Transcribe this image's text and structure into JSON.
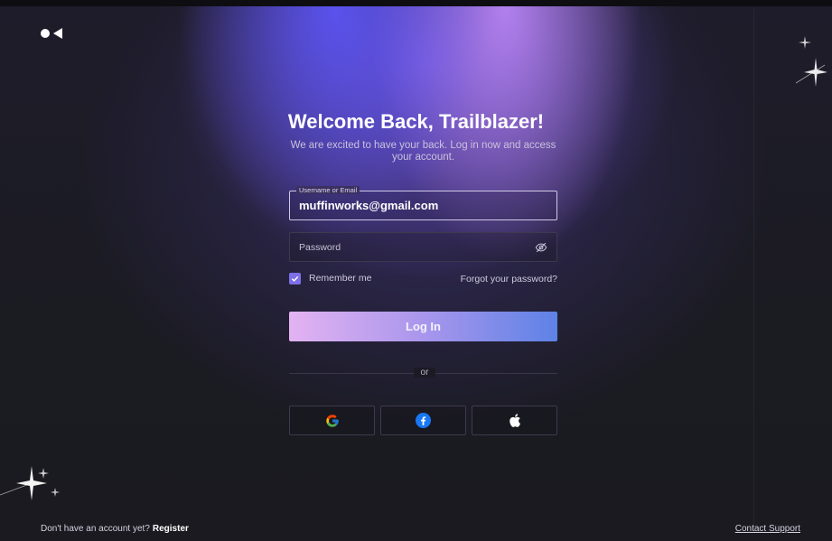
{
  "brand": {
    "logo": "logo-mark"
  },
  "header": {
    "title": "Welcome Back, Trailblazer!",
    "subtitle": "We are excited to have your back. Log in now and access your account."
  },
  "form": {
    "username": {
      "label": "Username or Email",
      "value": "muffinworks@gmail.com"
    },
    "password": {
      "placeholder": "Password",
      "icon": "eye-off-icon"
    },
    "remember": {
      "label": "Remember me",
      "checked": true
    },
    "forgot_label": "Forgot your password?",
    "submit_label": "Log In"
  },
  "divider": {
    "label": "or"
  },
  "social": [
    {
      "name": "google",
      "icon": "google-icon"
    },
    {
      "name": "facebook",
      "icon": "facebook-icon"
    },
    {
      "name": "apple",
      "icon": "apple-icon"
    }
  ],
  "footer": {
    "prompt": "Don't have an account yet?",
    "register_label": "Register",
    "contact_label": "Contact Support"
  },
  "colors": {
    "accent": "#7d6fe8",
    "button_gradient_start": "#e3b3f2",
    "button_gradient_end": "#5d82e6",
    "background": "#1b1b22"
  }
}
